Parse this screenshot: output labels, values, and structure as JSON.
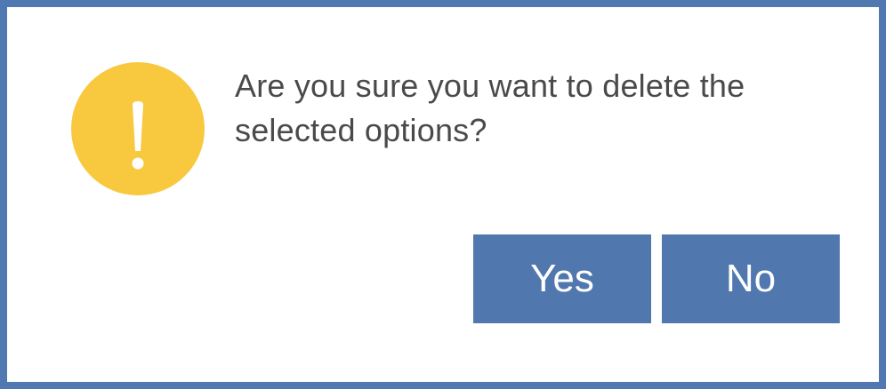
{
  "dialog": {
    "message": "Are you sure you want to delete the selected options?",
    "icon": "warning-exclamation-icon",
    "yes_label": "Yes",
    "no_label": "No"
  },
  "colors": {
    "border": "#4f79b0",
    "icon_fill": "#f8c83e",
    "button_bg": "#5178ae",
    "button_text": "#ffffff",
    "message_text": "#4a4a4a"
  }
}
